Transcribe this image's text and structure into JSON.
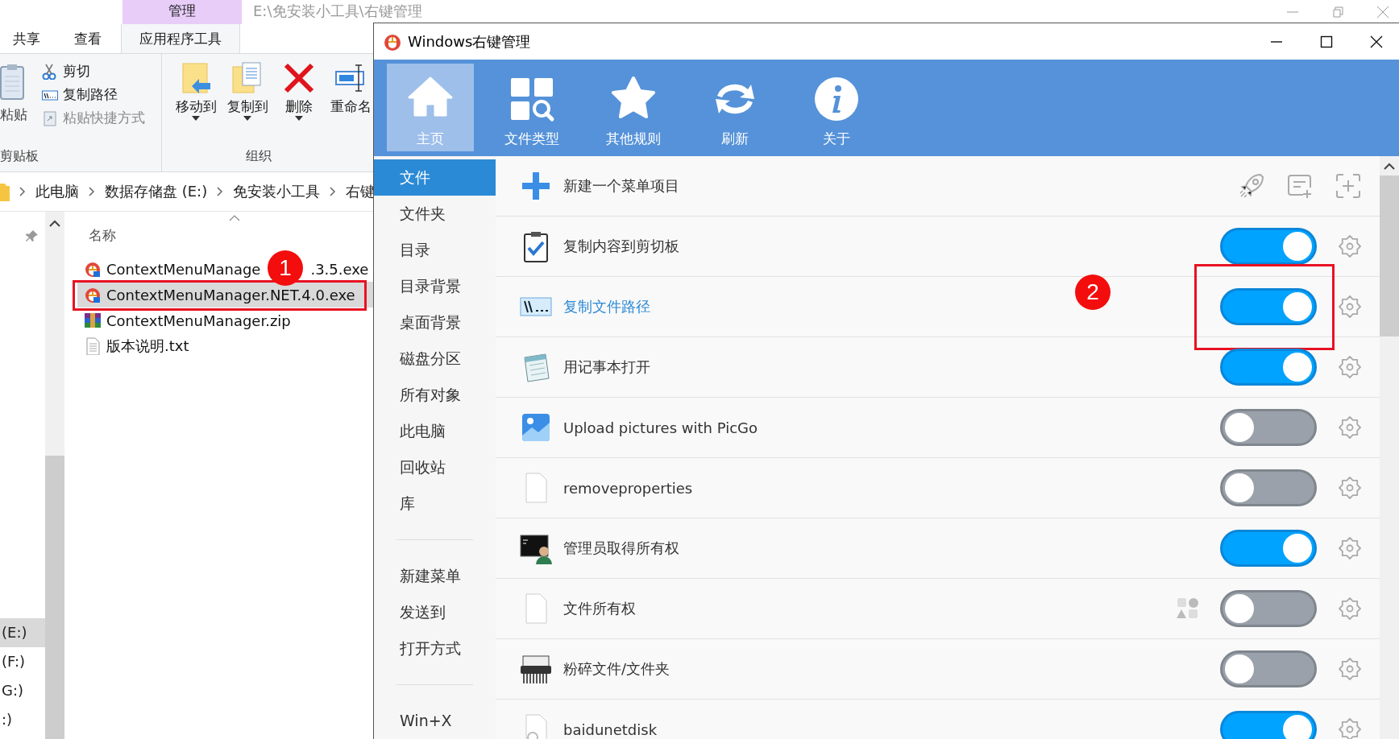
{
  "explorer": {
    "path_title": "E:\\免安装小工具\\右键管理",
    "context_tab": "管理",
    "tabs": [
      {
        "label": "共享",
        "selected": false
      },
      {
        "label": "查看",
        "selected": false
      },
      {
        "label": "应用程序工具",
        "selected": true
      }
    ],
    "clipboard": {
      "paste": "粘贴",
      "items": [
        {
          "label": "剪切",
          "disabled": false
        },
        {
          "label": "复制路径",
          "disabled": false
        },
        {
          "label": "粘贴快捷方式",
          "disabled": true
        }
      ],
      "group": "剪贴板"
    },
    "organize": {
      "buttons": [
        {
          "label": "移动到",
          "dropdown": true
        },
        {
          "label": "复制到",
          "dropdown": true
        },
        {
          "label": "删除",
          "dropdown": true
        },
        {
          "label": "重命名",
          "dropdown": false
        }
      ],
      "group": "组织"
    },
    "breadcrumb": [
      "此电脑",
      "数据存储盘 (E:)",
      "免安装小工具",
      "右键"
    ],
    "column": "名称",
    "files": [
      {
        "name_parts": [
          "ContextMenuManage",
          ".3.5.exe"
        ],
        "selected": false,
        "framed": false
      },
      {
        "name": "ContextMenuManager.NET.4.0.exe",
        "selected": true,
        "framed": true
      },
      {
        "name": "ContextMenuManager.zip",
        "selected": false,
        "framed": false
      },
      {
        "name": "版本说明.txt",
        "selected": false,
        "framed": false
      }
    ],
    "drives": [
      {
        "label": "(E:)",
        "selected": true
      },
      {
        "label": "(F:)",
        "selected": false
      },
      {
        "label": "G:)",
        "selected": false
      },
      {
        "label": ":)",
        "selected": false
      }
    ]
  },
  "app": {
    "title": "Windows右键管理",
    "toolbar": [
      {
        "label": "主页",
        "selected": true
      },
      {
        "label": "文件类型",
        "selected": false
      },
      {
        "label": "其他规则",
        "selected": false
      },
      {
        "label": "刷新",
        "selected": false
      },
      {
        "label": "关于",
        "selected": false
      }
    ],
    "nav_groups": [
      [
        {
          "label": "文件",
          "selected": true
        },
        {
          "label": "文件夹",
          "selected": false
        },
        {
          "label": "目录",
          "selected": false
        },
        {
          "label": "目录背景",
          "selected": false
        },
        {
          "label": "桌面背景",
          "selected": false
        },
        {
          "label": "磁盘分区",
          "selected": false
        },
        {
          "label": "所有对象",
          "selected": false
        },
        {
          "label": "此电脑",
          "selected": false
        },
        {
          "label": "回收站",
          "selected": false
        },
        {
          "label": "库",
          "selected": false
        }
      ],
      [
        {
          "label": "新建菜单",
          "selected": false
        },
        {
          "label": "发送到",
          "selected": false
        },
        {
          "label": "打开方式",
          "selected": false
        }
      ],
      [
        {
          "label": "Win+X",
          "selected": false
        }
      ]
    ],
    "rows": [
      {
        "kind": "action",
        "label": "新建一个菜单项目"
      },
      {
        "kind": "toggle",
        "label": "复制内容到剪切板",
        "on": true,
        "highlighted": false,
        "framed": false
      },
      {
        "kind": "toggle",
        "label": "复制文件路径",
        "on": true,
        "highlighted": true,
        "framed": true
      },
      {
        "kind": "toggle",
        "label": "用记事本打开",
        "on": true,
        "highlighted": false,
        "framed": false
      },
      {
        "kind": "toggle",
        "label": "Upload pictures with PicGo",
        "on": false,
        "highlighted": false,
        "framed": false
      },
      {
        "kind": "toggle",
        "label": "removeproperties",
        "on": false,
        "highlighted": false,
        "framed": false
      },
      {
        "kind": "toggle",
        "label": "管理员取得所有权",
        "on": true,
        "highlighted": false,
        "framed": false
      },
      {
        "kind": "toggle",
        "label": "文件所有权",
        "on": false,
        "highlighted": false,
        "framed": false,
        "shapes": true
      },
      {
        "kind": "toggle",
        "label": "粉碎文件/文件夹",
        "on": false,
        "highlighted": false,
        "framed": false
      },
      {
        "kind": "toggle",
        "label": "baidunetdisk",
        "on": true,
        "highlighted": false,
        "framed": false
      }
    ]
  },
  "markers": [
    "1",
    "2"
  ]
}
